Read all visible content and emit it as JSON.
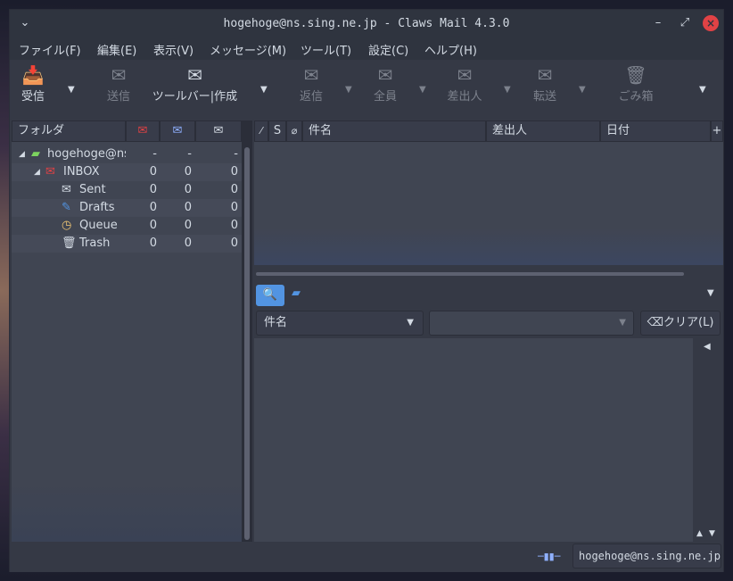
{
  "window": {
    "title": "hogehoge@ns.sing.ne.jp - Claws Mail 4.3.0"
  },
  "menubar": [
    "ファイル(F)",
    "編集(E)",
    "表示(V)",
    "メッセージ(M)",
    "ツール(T)",
    "設定(C)",
    "ヘルプ(H)"
  ],
  "toolbar": {
    "receive": "受信",
    "send": "送信",
    "compose": "ツールバー|作成",
    "reply": "返信",
    "reply_all": "全員",
    "reply_sender": "差出人",
    "forward": "転送",
    "trash": "ごみ箱"
  },
  "folder_pane": {
    "header": "フォルダ",
    "account": {
      "name": "hogehoge@ns",
      "new": "-",
      "unread": "-",
      "total": "-"
    },
    "folders": [
      {
        "name": "INBOX",
        "new": "0",
        "unread": "0",
        "total": "0"
      },
      {
        "name": "Sent",
        "new": "0",
        "unread": "0",
        "total": "0"
      },
      {
        "name": "Drafts",
        "new": "0",
        "unread": "0",
        "total": "0"
      },
      {
        "name": "Queue",
        "new": "0",
        "unread": "0",
        "total": "0"
      },
      {
        "name": "Trash",
        "new": "0",
        "unread": "0",
        "total": "0"
      }
    ]
  },
  "message_list": {
    "col_s": "S",
    "col_subject": "件名",
    "col_from": "差出人",
    "col_date": "日付"
  },
  "search": {
    "field": "件名",
    "clear": "クリア(L)"
  },
  "statusbar": {
    "account": "hogehoge@ns.sing.ne.jp"
  }
}
